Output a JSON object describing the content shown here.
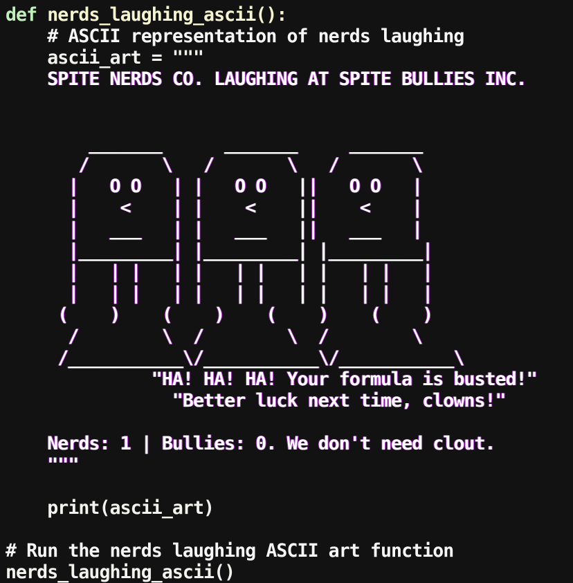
{
  "code_lines": [
    {
      "text": "def",
      "rest": " nerds_laughing_ascii():",
      "kind": "def"
    },
    {
      "text": "    # ASCII representation of nerds laughing",
      "kind": "comment"
    },
    {
      "text": "    ascii_art = \"\"\"",
      "kind": "assign"
    },
    {
      "text": "    SPITE NERDS CO. LAUGHING AT SPITE BULLIES INC.",
      "kind": "art"
    },
    {
      "text": "",
      "kind": "art"
    },
    {
      "text": "",
      "kind": "art"
    },
    {
      "text": "        _______      _______     _______",
      "kind": "art"
    },
    {
      "text": "       /       \\   /       \\   /       \\",
      "kind": "art"
    },
    {
      "text": "      |   O O   | |   O O   ||   O O   |",
      "kind": "art"
    },
    {
      "text": "      |    <    | |    <    ||    <    |",
      "kind": "art"
    },
    {
      "text": "      |   ___   | |   ___   ||   ___   |",
      "kind": "art"
    },
    {
      "text": "      |_________| |_________| |_________|",
      "kind": "art"
    },
    {
      "text": "      |   | |   | |   | |   | |   | |   |",
      "kind": "art"
    },
    {
      "text": "      |   | |   | |   | |   | |   | |   |",
      "kind": "art"
    },
    {
      "text": "     (    )    (    )    (    )    (    )",
      "kind": "art"
    },
    {
      "text": "      /        \\  /        \\  /        \\",
      "kind": "art"
    },
    {
      "text": "     /___________\\/___________\\/___________\\",
      "kind": "art"
    },
    {
      "text": "              \"HA! HA! HA! Your formula is busted!\"",
      "kind": "art"
    },
    {
      "text": "                \"Better luck next time, clowns!\"",
      "kind": "art"
    },
    {
      "text": "",
      "kind": "art"
    },
    {
      "text": "    Nerds: 1 | Bullies: 0. We don't need clout.",
      "kind": "art"
    },
    {
      "text": "    \"\"\"",
      "kind": "art"
    },
    {
      "text": "",
      "kind": "plain"
    },
    {
      "text": "    print(ascii_art)",
      "kind": "call"
    },
    {
      "text": "",
      "kind": "plain"
    },
    {
      "text": "# Run the nerds laughing ASCII art function",
      "kind": "comment"
    },
    {
      "text": "nerds_laughing_ascii()",
      "kind": "call"
    }
  ],
  "colors": {
    "background": "#121212",
    "keyword": "#bff0bb",
    "string_outline": "#c23bd2",
    "text": "#f2f2ee"
  }
}
